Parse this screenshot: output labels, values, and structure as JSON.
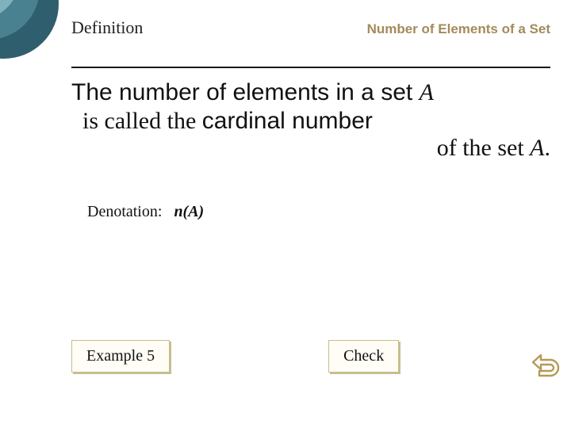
{
  "colors": {
    "accent_gold": "#a58a5a",
    "accent_gold_light": "#b49a56",
    "button_bg": "#fffdf5",
    "button_border": "#c8bd8f",
    "teal_dark": "#2f5f6f",
    "teal_mid": "#4a8191",
    "teal_light": "#7fb2be"
  },
  "header": {
    "left": "Definition",
    "right": "Number of Elements of a Set"
  },
  "body": {
    "line1_prefix": "The number of elements in a set  ",
    "line1_setvar": "A",
    "line2_lead": "is called the ",
    "line2_term": "cardinal number",
    "line3_prefix": "of the set ",
    "line3_setvar": "A",
    "line3_suffix": "."
  },
  "denotation": {
    "label": "Denotation:",
    "value": "n(A)"
  },
  "buttons": {
    "example": "Example 5",
    "check": "Check"
  },
  "icons": {
    "return": "return-icon"
  }
}
